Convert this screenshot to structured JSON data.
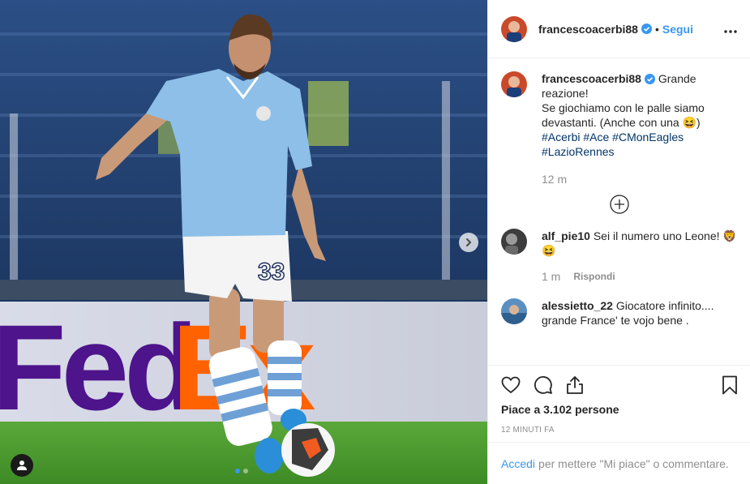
{
  "post": {
    "username": "francescoacerbi88",
    "separator": "•",
    "follow_label": "Segui",
    "caption_line1": "Grande",
    "caption_line2": "reazione!",
    "caption_line3": "Se giochiamo con le palle siamo",
    "caption_line4": "devastanti. (Anche con una 😆)",
    "hashtags_line1": [
      "#Acerbi",
      "#Ace",
      "#CMonEagles"
    ],
    "hashtags_line2": [
      "#LazioRennes"
    ],
    "caption_time": "12 m"
  },
  "comments": [
    {
      "username": "alf_pie10",
      "text": "Sei il numero uno Leone! 🦁",
      "text2": "😆",
      "time": "1 m",
      "reply_label": "Rispondi"
    },
    {
      "username": "alessietto_22",
      "text": "Giocatore infinito....",
      "text2": "grande France' te vojo bene ."
    }
  ],
  "stats": {
    "likes_label": "Piace a 3.102 persone",
    "post_time": "12 MINUTI FA"
  },
  "login": {
    "link_label": "Accedi",
    "text": "per mettere \"Mi piace\" o commentare."
  },
  "photo": {
    "jersey_number": "33",
    "banner_text": "FedEx"
  },
  "icons": [
    "chevron-right-icon",
    "user-tag-icon",
    "more-icon",
    "verified-icon",
    "add-circle-icon",
    "heart-icon",
    "comment-icon",
    "share-icon",
    "bookmark-icon"
  ],
  "colors": {
    "accent": "#3897f0",
    "hashtag": "#003569",
    "muted": "#8e8e8e",
    "verified": "#3897f0"
  }
}
